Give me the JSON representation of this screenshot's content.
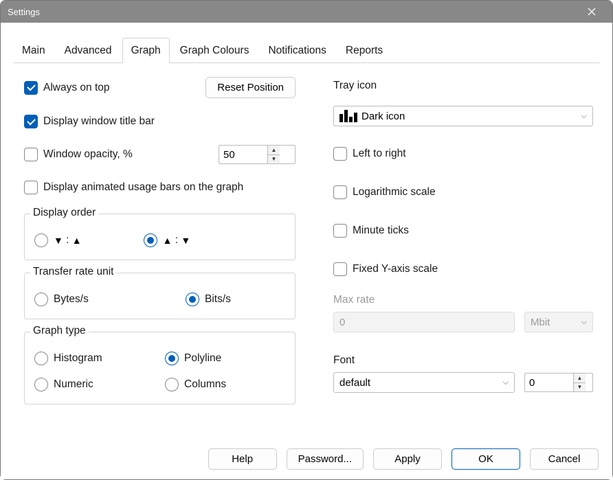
{
  "window": {
    "title": "Settings"
  },
  "tabs": [
    "Main",
    "Advanced",
    "Graph",
    "Graph Colours",
    "Notifications",
    "Reports"
  ],
  "active_tab": 2,
  "left": {
    "always_on_top": {
      "label": "Always on top",
      "checked": true
    },
    "reset_position_btn": "Reset Position",
    "display_titlebar": {
      "label": "Display window title bar",
      "checked": true
    },
    "window_opacity": {
      "label": "Window opacity, %",
      "checked": false,
      "value": "50"
    },
    "animated_bars": {
      "label": "Display animated usage bars on the graph",
      "checked": false
    },
    "display_order": {
      "legend": "Display order",
      "options": [
        {
          "label_a": "▼",
          "label_b": "▲",
          "selected": false
        },
        {
          "label_a": "▲",
          "label_b": "▼",
          "selected": true
        }
      ]
    },
    "transfer_rate": {
      "legend": "Transfer rate unit",
      "bytes": {
        "label": "Bytes/s",
        "selected": false
      },
      "bits": {
        "label": "Bits/s",
        "selected": true
      }
    },
    "graph_type": {
      "legend": "Graph type",
      "histogram": {
        "label": "Histogram",
        "selected": false
      },
      "polyline": {
        "label": "Polyline",
        "selected": true
      },
      "numeric": {
        "label": "Numeric",
        "selected": false
      },
      "columns": {
        "label": "Columns",
        "selected": false
      }
    }
  },
  "right": {
    "tray_icon": {
      "label": "Tray icon",
      "value": "Dark icon"
    },
    "left_to_right": {
      "label": "Left to right",
      "checked": false
    },
    "log_scale": {
      "label": "Logarithmic scale",
      "checked": false
    },
    "minute_ticks": {
      "label": "Minute ticks",
      "checked": false
    },
    "fixed_y": {
      "label": "Fixed Y-axis scale",
      "checked": false
    },
    "max_rate": {
      "label": "Max rate",
      "value": "0",
      "unit": "Mbit",
      "disabled": true
    },
    "font": {
      "label": "Font",
      "value": "default",
      "size": "0"
    }
  },
  "footer": {
    "help": "Help",
    "password": "Password...",
    "apply": "Apply",
    "ok": "OK",
    "cancel": "Cancel"
  }
}
